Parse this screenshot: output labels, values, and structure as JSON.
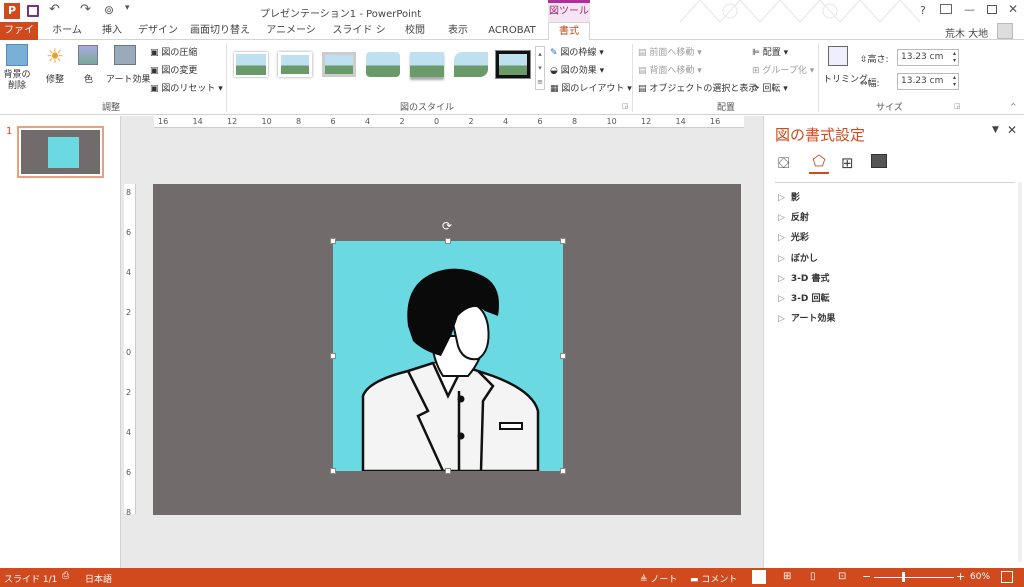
{
  "window": {
    "title": "プレゼンテーション1 - PowerPoint",
    "context_tab_group": "図ツール",
    "help": "?"
  },
  "user": {
    "name": "荒木 大地"
  },
  "tabs": {
    "file": "ファイル",
    "home": "ホーム",
    "insert": "挿入",
    "design": "デザイン",
    "transitions": "画面切り替え",
    "animations": "アニメーション",
    "slideshow": "スライド ショー",
    "review": "校閲",
    "view": "表示",
    "acrobat": "ACROBAT",
    "format": "書式"
  },
  "ribbon": {
    "adjust": {
      "remove_bg": "背景の\n削除",
      "corrections": "修整",
      "color": "色",
      "artistic": "アート効果",
      "compress": "図の圧縮",
      "change": "図の変更",
      "reset": "図のリセット",
      "label": "調整"
    },
    "styles": {
      "border": "図の枠線",
      "effects": "図の効果",
      "layout": "図のレイアウト",
      "label": "図のスタイル"
    },
    "arrange": {
      "forward": "前面へ移動",
      "backward": "背面へ移動",
      "selection_pane": "オブジェクトの選択と表示",
      "align": "配置",
      "group": "グループ化",
      "rotate": "回転",
      "label": "配置"
    },
    "size": {
      "crop": "トリミング",
      "height_label": "高さ:",
      "height_value": "13.23 cm",
      "width_label": "幅:",
      "width_value": "13.23 cm",
      "label": "サイズ"
    }
  },
  "thumbnail": {
    "number": "1"
  },
  "ruler": {
    "h_ticks": [
      "16",
      "14",
      "12",
      "10",
      "8",
      "6",
      "4",
      "2",
      "0",
      "2",
      "4",
      "6",
      "8",
      "10",
      "12",
      "14",
      "16"
    ],
    "v_ticks": [
      "8",
      "6",
      "4",
      "2",
      "0",
      "2",
      "4",
      "6",
      "8"
    ]
  },
  "format_pane": {
    "title": "図の書式設定",
    "items": [
      "影",
      "反射",
      "光彩",
      "ぼかし",
      "3-D 書式",
      "3-D 回転",
      "アート効果"
    ]
  },
  "status": {
    "slide": "スライド 1/1",
    "language": "日本語",
    "notes": "ノート",
    "comments": "コメント",
    "zoom": "60%"
  },
  "colors": {
    "accent": "#d04a1e",
    "slide_bg": "#716b6b",
    "photo_bg": "#6ad9e2"
  }
}
